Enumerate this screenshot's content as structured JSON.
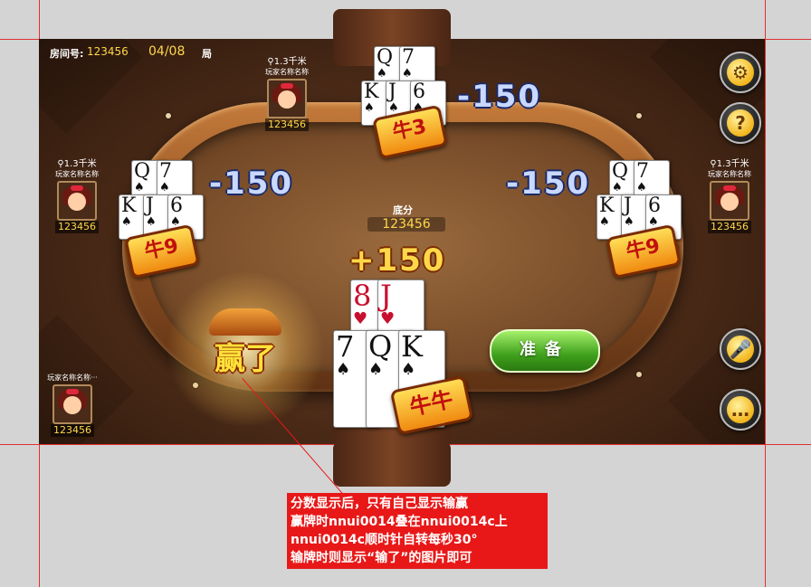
{
  "header": {
    "room_label": "房间号:",
    "room_id": "123456",
    "round": "04/08",
    "round_unit": "局"
  },
  "players": {
    "top": {
      "distance": "1.3千米",
      "name": "玩家名称名称",
      "score": "123456"
    },
    "left": {
      "distance": "1.3千米",
      "name": "玩家名称名称",
      "score": "123456"
    },
    "right": {
      "distance": "1.3千米",
      "name": "玩家名称名称",
      "score": "123456"
    },
    "self": {
      "name": "玩家名称名称···",
      "score": "123456"
    }
  },
  "hands": {
    "top": {
      "cards_row1": [
        "Q",
        "7"
      ],
      "cards_row2": [
        "K",
        "J",
        "6"
      ],
      "result": "牛3",
      "delta": "-150"
    },
    "left": {
      "cards_row1": [
        "Q",
        "7"
      ],
      "cards_row2": [
        "K",
        "J",
        "6"
      ],
      "result": "牛9",
      "delta": "-150"
    },
    "right": {
      "cards_row1": [
        "Q",
        "7"
      ],
      "cards_row2": [
        "K",
        "J",
        "6"
      ],
      "result": "牛9",
      "delta": "-150"
    },
    "self": {
      "cards_row1": [
        "8",
        "J"
      ],
      "cards_row2": [
        "7",
        "Q",
        "K"
      ],
      "result": "牛牛",
      "delta": "+150",
      "outcome": "赢了"
    }
  },
  "table": {
    "base_label": "底分",
    "base_value": "123456"
  },
  "buttons": {
    "ready": "准备",
    "help": "?"
  },
  "annotation": {
    "lines": [
      "分数显示后，只有自己显示输赢",
      "赢牌时nnui0014叠在nnui0014c上",
      "nnui0014c顺时针自转每秒30°",
      "输牌时则显示“输了”的图片即可"
    ]
  },
  "colors": {
    "gold": "#ffd84a",
    "table_wood": "#8a4e22",
    "ready_green": "#3fa01c",
    "guide_red": "#e03030"
  }
}
